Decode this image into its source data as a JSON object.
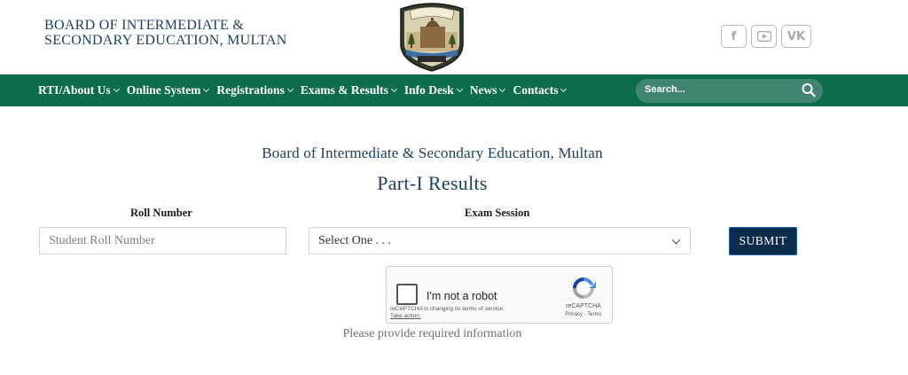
{
  "header": {
    "org_line1": "BOARD OF INTERMEDIATE &",
    "org_line2": "SECONDARY EDUCATION, MULTAN",
    "logo_icon": "bise-multan-crest",
    "social": [
      {
        "icon": "facebook-icon",
        "glyph": "f"
      },
      {
        "icon": "youtube-icon",
        "glyph": "▶"
      },
      {
        "icon": "vk-icon",
        "glyph": "VK"
      }
    ]
  },
  "nav": {
    "items": [
      {
        "label": "RTI/About Us"
      },
      {
        "label": "Online System"
      },
      {
        "label": "Registrations"
      },
      {
        "label": "Exams & Results"
      },
      {
        "label": "Info Desk"
      },
      {
        "label": "News"
      },
      {
        "label": "Contacts"
      }
    ],
    "search_placeholder": "Search...",
    "color": "#0d6b4e"
  },
  "main": {
    "board_title": "Board of Intermediate & Secondary Education, Multan",
    "page_title": "Part-I Results",
    "roll_label": "Roll Number",
    "roll_placeholder": "Student Roll Number",
    "session_label": "Exam Session",
    "session_selected": "Select One . . .",
    "submit_label": "SUBMIT",
    "info_message": "Please provide required information"
  },
  "captcha": {
    "label": "I'm not a robot",
    "note_line1": "reCAPTCHA is changing its terms of service.",
    "note_link": "Take action.",
    "brand": "reCAPTCHA",
    "terms": "Privacy - Terms"
  }
}
